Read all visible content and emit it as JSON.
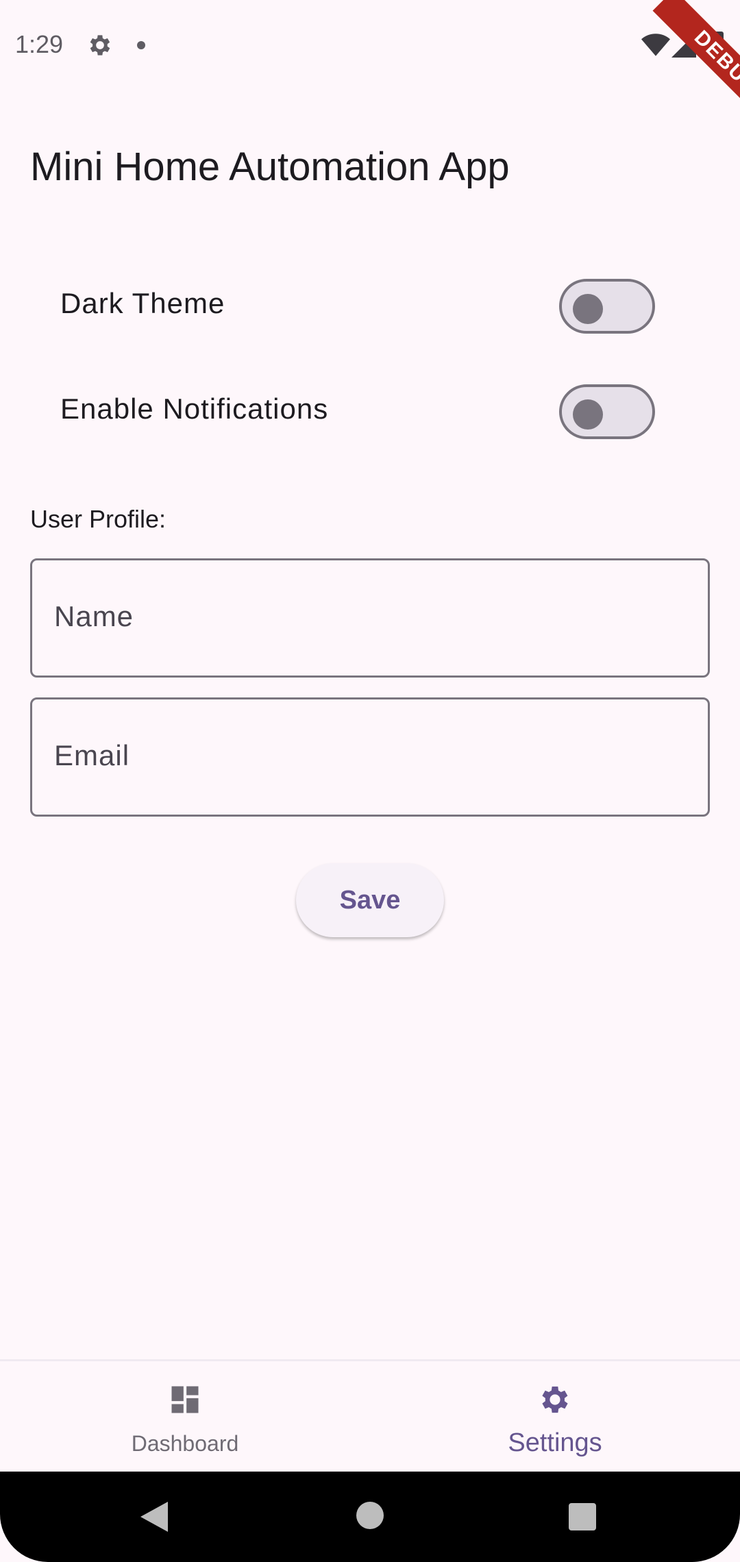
{
  "status_bar": {
    "time": "1:29",
    "icons": [
      "gear-icon",
      "notification-dot-icon",
      "wifi-icon",
      "signal-icon",
      "battery-icon"
    ]
  },
  "debug_banner": "DEBUG",
  "app_title": "Mini Home Automation App",
  "settings": {
    "toggles": [
      {
        "label": "Dark Theme",
        "on": false
      },
      {
        "label": "Enable Notifications",
        "on": false
      }
    ],
    "profile_label": "User Profile:",
    "name_field": {
      "placeholder": "Name",
      "value": ""
    },
    "email_field": {
      "placeholder": "Email",
      "value": ""
    },
    "save_label": "Save"
  },
  "bottom_nav": {
    "items": [
      {
        "label": "Dashboard",
        "icon": "dashboard-icon",
        "active": false
      },
      {
        "label": "Settings",
        "icon": "settings-gear-icon",
        "active": true
      }
    ]
  },
  "colors": {
    "background": "#fef7fb",
    "accent": "#65558f",
    "outline": "#79747e",
    "debug_banner": "#b3261e"
  }
}
